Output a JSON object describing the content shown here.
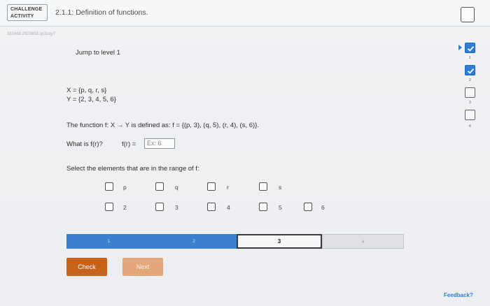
{
  "header": {
    "badge_line1": "CHALLENGE",
    "badge_line2": "ACTIVITY",
    "title": "2.1.1: Definition of functions."
  },
  "session_id": "381668.2503658.qx3zqy7",
  "jump_label": "Jump to level 1",
  "problem": {
    "x_set": "X = {p, q, r, s}",
    "y_set": "Y = {2, 3, 4, 5, 6}",
    "function_def": "The function f: X → Y is defined as: f = {(p, 3), (q, 5), (r, 4), (s, 6)}.",
    "question_prompt": "What is f(r)?",
    "answer_label": "f(r) =",
    "answer_placeholder": "Ex: 6",
    "range_prompt": "Select the elements that are in the range of f:"
  },
  "choices_row1": [
    "p",
    "q",
    "r",
    "s"
  ],
  "choices_row2": [
    "2",
    "3",
    "4",
    "5",
    "6"
  ],
  "progress": {
    "segments": [
      "1",
      "2",
      "3",
      "4"
    ],
    "current_level": 3,
    "completed_levels": 2
  },
  "buttons": {
    "check": "Check",
    "next": "Next"
  },
  "side_levels": {
    "labels": [
      "1",
      "2",
      "3",
      "4"
    ],
    "completed": 2
  },
  "feedback_link": "Feedback?",
  "colors": {
    "accent_blue": "#3b7fd0",
    "check_orange": "#c8611a",
    "next_orange_disabled": "#e2a77a"
  }
}
